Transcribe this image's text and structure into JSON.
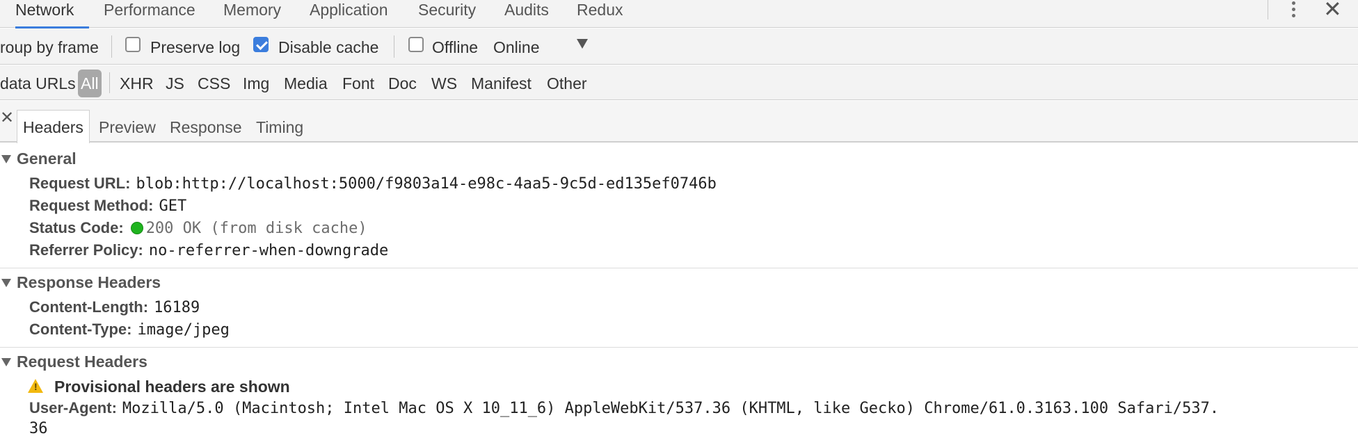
{
  "panel_tabs": [
    "Network",
    "Performance",
    "Memory",
    "Application",
    "Security",
    "Audits",
    "Redux"
  ],
  "toolbar": {
    "group_by_frame_label": "roup by frame",
    "preserve_log": {
      "label": "Preserve log",
      "checked": false
    },
    "disable_cache": {
      "label": "Disable cache",
      "checked": true
    },
    "offline": {
      "label": "Offline",
      "checked": false
    },
    "throttling_value": "Online"
  },
  "filter": {
    "hide_data_urls_label": "data URLs",
    "types": [
      "All",
      "XHR",
      "JS",
      "CSS",
      "Img",
      "Media",
      "Font",
      "Doc",
      "WS",
      "Manifest",
      "Other"
    ],
    "selected": "All"
  },
  "detail_tabs": [
    "Headers",
    "Preview",
    "Response",
    "Timing"
  ],
  "general": {
    "title": "General",
    "request_url": {
      "key": "Request URL:",
      "value": "blob:http://localhost:5000/f9803a14-e98c-4aa5-9c5d-ed135ef0746b"
    },
    "request_method": {
      "key": "Request Method:",
      "value": "GET"
    },
    "status_code": {
      "key": "Status Code:",
      "value": "200 OK (from disk cache)"
    },
    "referrer_policy": {
      "key": "Referrer Policy:",
      "value": "no-referrer-when-downgrade"
    }
  },
  "response_headers": {
    "title": "Response Headers",
    "content_length": {
      "key": "Content-Length:",
      "value": "16189"
    },
    "content_type": {
      "key": "Content-Type:",
      "value": "image/jpeg"
    }
  },
  "request_headers": {
    "title": "Request Headers",
    "provisional_warning": "Provisional headers are shown",
    "user_agent": {
      "key": "User-Agent:",
      "value": "Mozilla/5.0 (Macintosh; Intel Mac OS X 10_11_6) AppleWebKit/537.36 (KHTML, like Gecko) Chrome/61.0.3163.100 Safari/537.",
      "value_cont": "36"
    }
  },
  "colors": {
    "accent": "#3b7ddd",
    "status_ok": "#1fb41f",
    "warning": "#f2b90f"
  }
}
